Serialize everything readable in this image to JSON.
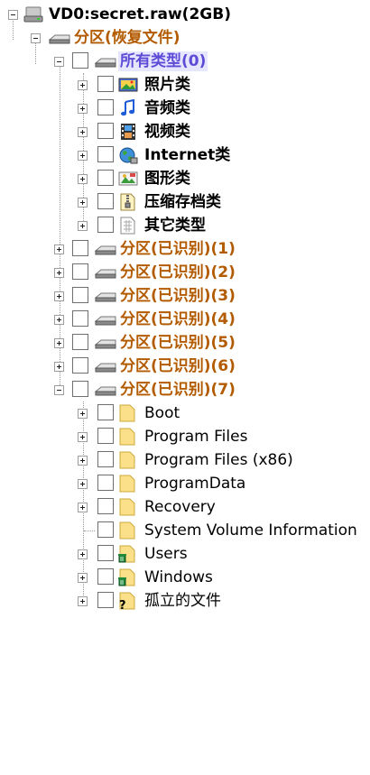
{
  "tree": {
    "root": {
      "label": "VD0:secret.raw(2GB)"
    },
    "partition_recovered": {
      "label": "分区(恢复文件)"
    },
    "all_types": {
      "label": "所有类型(0)"
    },
    "type_items": [
      {
        "label": "照片类",
        "icon": "photo-icon"
      },
      {
        "label": "音频类",
        "icon": "music-note-icon"
      },
      {
        "label": "视频类",
        "icon": "film-icon"
      },
      {
        "label": "Internet类",
        "icon": "globe-icon"
      },
      {
        "label": "图形类",
        "icon": "image-icon"
      },
      {
        "label": "压缩存档类",
        "icon": "archive-icon"
      },
      {
        "label": "其它类型",
        "icon": "grid-file-icon"
      }
    ],
    "partitions": [
      {
        "label": "分区(已识别)(1)"
      },
      {
        "label": "分区(已识别)(2)"
      },
      {
        "label": "分区(已识别)(3)"
      },
      {
        "label": "分区(已识别)(4)"
      },
      {
        "label": "分区(已识别)(5)"
      },
      {
        "label": "分区(已识别)(6)"
      },
      {
        "label": "分区(已识别)(7)"
      }
    ],
    "folders": [
      {
        "label": "Boot",
        "icon": "folder-icon"
      },
      {
        "label": "Program Files",
        "icon": "folder-icon"
      },
      {
        "label": "Program Files (x86)",
        "icon": "folder-icon"
      },
      {
        "label": "ProgramData",
        "icon": "folder-icon"
      },
      {
        "label": "Recovery",
        "icon": "folder-icon"
      },
      {
        "label": "System Volume Information",
        "icon": "folder-icon"
      },
      {
        "label": "Users",
        "icon": "deleted-folder-icon"
      },
      {
        "label": "Windows",
        "icon": "deleted-folder-icon"
      },
      {
        "label": "孤立的文件",
        "icon": "unknown-folder-icon"
      }
    ]
  },
  "colors": {
    "partition_text": "#b35b00",
    "selected_text": "#5d4bd6",
    "selected_bg": "#e6e6ff"
  }
}
